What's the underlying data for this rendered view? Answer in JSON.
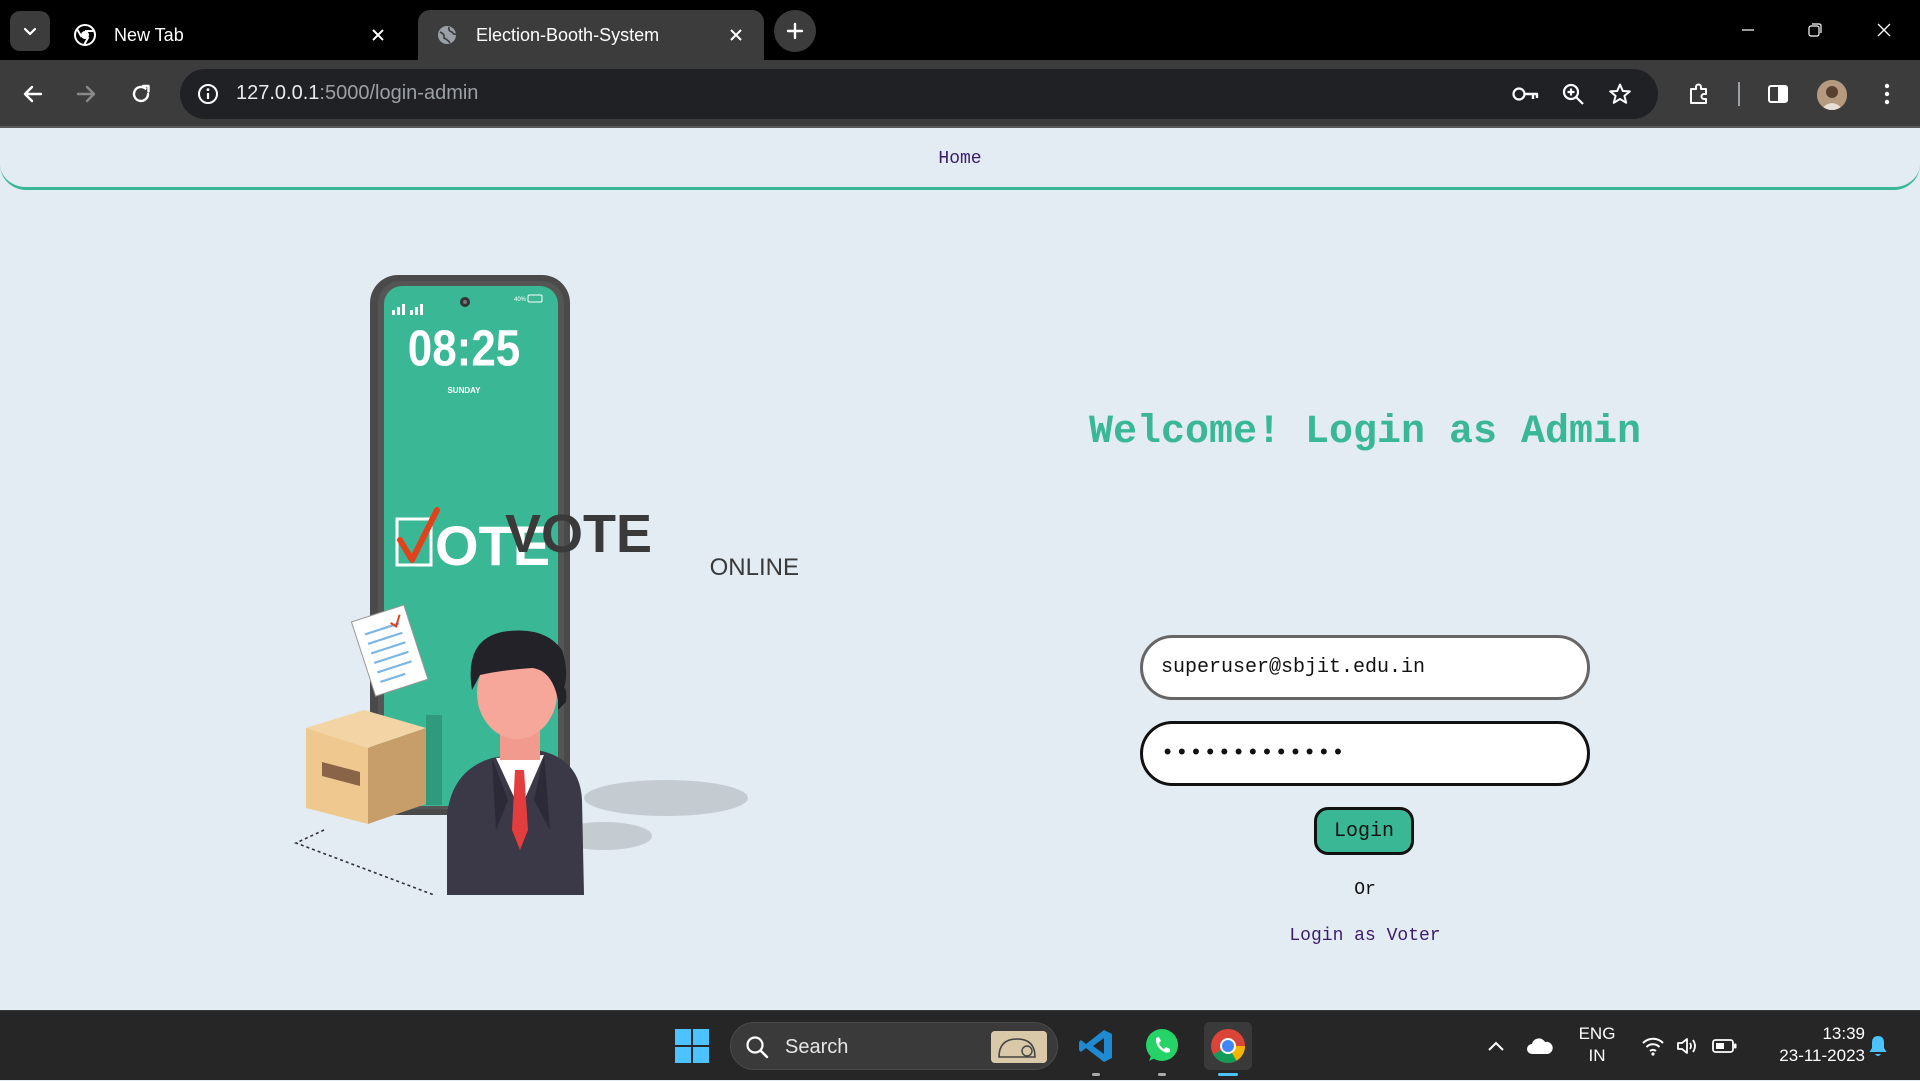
{
  "browser": {
    "tabs": [
      {
        "title": "New Tab",
        "active": false
      },
      {
        "title": "Election-Booth-System",
        "active": true
      }
    ],
    "url": {
      "host": "127.0.0.1",
      "rest": ":5000/login-admin"
    }
  },
  "navbar": {
    "home_label": "Home"
  },
  "illustration": {
    "phone_time": "08:25",
    "phone_day": "SUNDAY",
    "phone_battery": "40%",
    "phone_vote": "OTE",
    "brand_title": "VOTE",
    "brand_subtitle": "ONLINE"
  },
  "login": {
    "heading": "Welcome! Login as Admin",
    "email_value": "superuser@sbjit.edu.in",
    "password_masked": "•••••••••••••",
    "button_label": "Login",
    "or_text": "Or",
    "voter_link": "Login as Voter"
  },
  "taskbar": {
    "search_label": "Search",
    "lang_top": "ENG",
    "lang_bottom": "IN",
    "time": "13:39",
    "date": "23-11-2023"
  },
  "colors": {
    "accent": "#3ab795",
    "link": "#3b1d6b",
    "page_bg": "#e3ebf3"
  }
}
